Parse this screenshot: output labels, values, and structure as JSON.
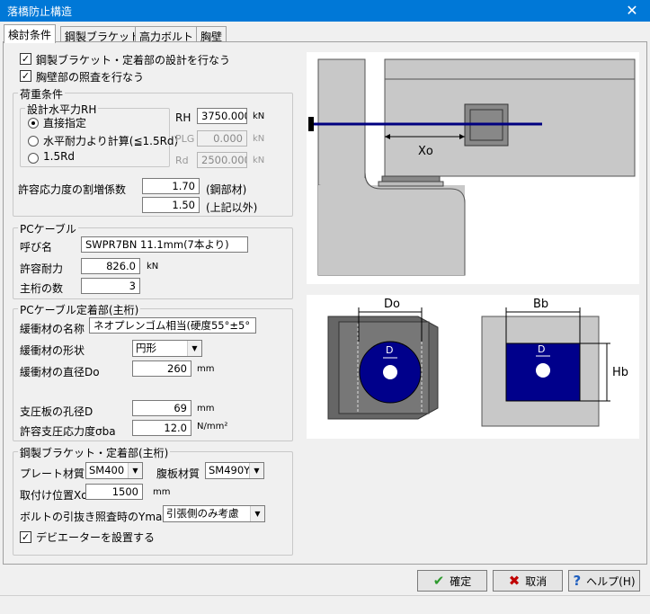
{
  "window": {
    "title": "落橋防止構造",
    "close_glyph": "✕"
  },
  "tabs": [
    "検討条件",
    "鋼製ブラケット",
    "高力ボルト",
    "胸壁"
  ],
  "options": {
    "bracket_design": {
      "label": "鋼製ブラケット・定着部の設計を行なう",
      "checked": true
    },
    "parapet_check": {
      "label": "胸壁部の照査を行なう",
      "checked": true
    }
  },
  "load": {
    "title": "荷重条件",
    "rh_group_title": "設計水平力RH",
    "radios": [
      {
        "label": "直接指定",
        "selected": true
      },
      {
        "label": "水平耐力より計算(≦1.5Rd)",
        "selected": false
      },
      {
        "label": "1.5Rd",
        "selected": false
      }
    ],
    "fields": [
      {
        "label": "RH",
        "value": "3750.000",
        "unit": "kN",
        "enabled": true
      },
      {
        "label": "PLG",
        "value": "0.000",
        "unit": "kN",
        "enabled": false
      },
      {
        "label": "Rd",
        "value": "2500.000",
        "unit": "kN",
        "enabled": false
      }
    ],
    "allowable_label": "許容応力度の割増係数",
    "allowable_steel": "1.70",
    "allowable_steel_note": "(鋼部材)",
    "allowable_other": "1.50",
    "allowable_other_note": "(上記以外)"
  },
  "pc_cable": {
    "title": "PCケーブル",
    "name_label": "呼び名",
    "name_value": "SWPR7BN 11.1mm(7本より)",
    "strength_label": "許容耐力",
    "strength_value": "826.0",
    "strength_unit": "kN",
    "girders_label": "主桁の数",
    "girders_value": "3"
  },
  "anchorage": {
    "title": "PCケーブル定着部(主桁)",
    "cushion_name_label": "緩衝材の名称",
    "cushion_name_value": "ネオプレンゴム相当(硬度55°±5°",
    "cushion_shape_label": "緩衝材の形状",
    "cushion_shape_value": "円形",
    "cushion_dia_label": "緩衝材の直径Do",
    "cushion_dia_value": "260",
    "cushion_dia_unit": "mm",
    "hole_label": "支圧板の孔径D",
    "hole_value": "69",
    "hole_unit": "mm",
    "bearing_label": "許容支圧応力度σba",
    "bearing_value": "12.0",
    "bearing_unit": "N/mm²"
  },
  "bracket": {
    "title": "鋼製ブラケット・定着部(主桁)",
    "plate_label": "プレート材質",
    "plate_value": "SM400",
    "web_label": "腹板材質",
    "web_value": "SM490Y",
    "position_label": "取付け位置Xo",
    "position_value": "1500",
    "position_unit": "mm",
    "ymax_label": "ボルトの引抜き照査時のYmax",
    "ymax_value": "引張側のみ考慮",
    "deviator_label": "デビエーターを設置する",
    "deviator_checked": true
  },
  "diagram": {
    "xo": "Xo",
    "do": "Do",
    "d": "D",
    "bb": "Bb",
    "hb": "Hb"
  },
  "buttons": {
    "ok": "確定",
    "cancel": "取消",
    "help": "ヘルプ(H)"
  },
  "colors": {
    "accent": "#0078d7",
    "navy": "#000080",
    "gray": "#c8c8c8",
    "dark": "#555555"
  }
}
